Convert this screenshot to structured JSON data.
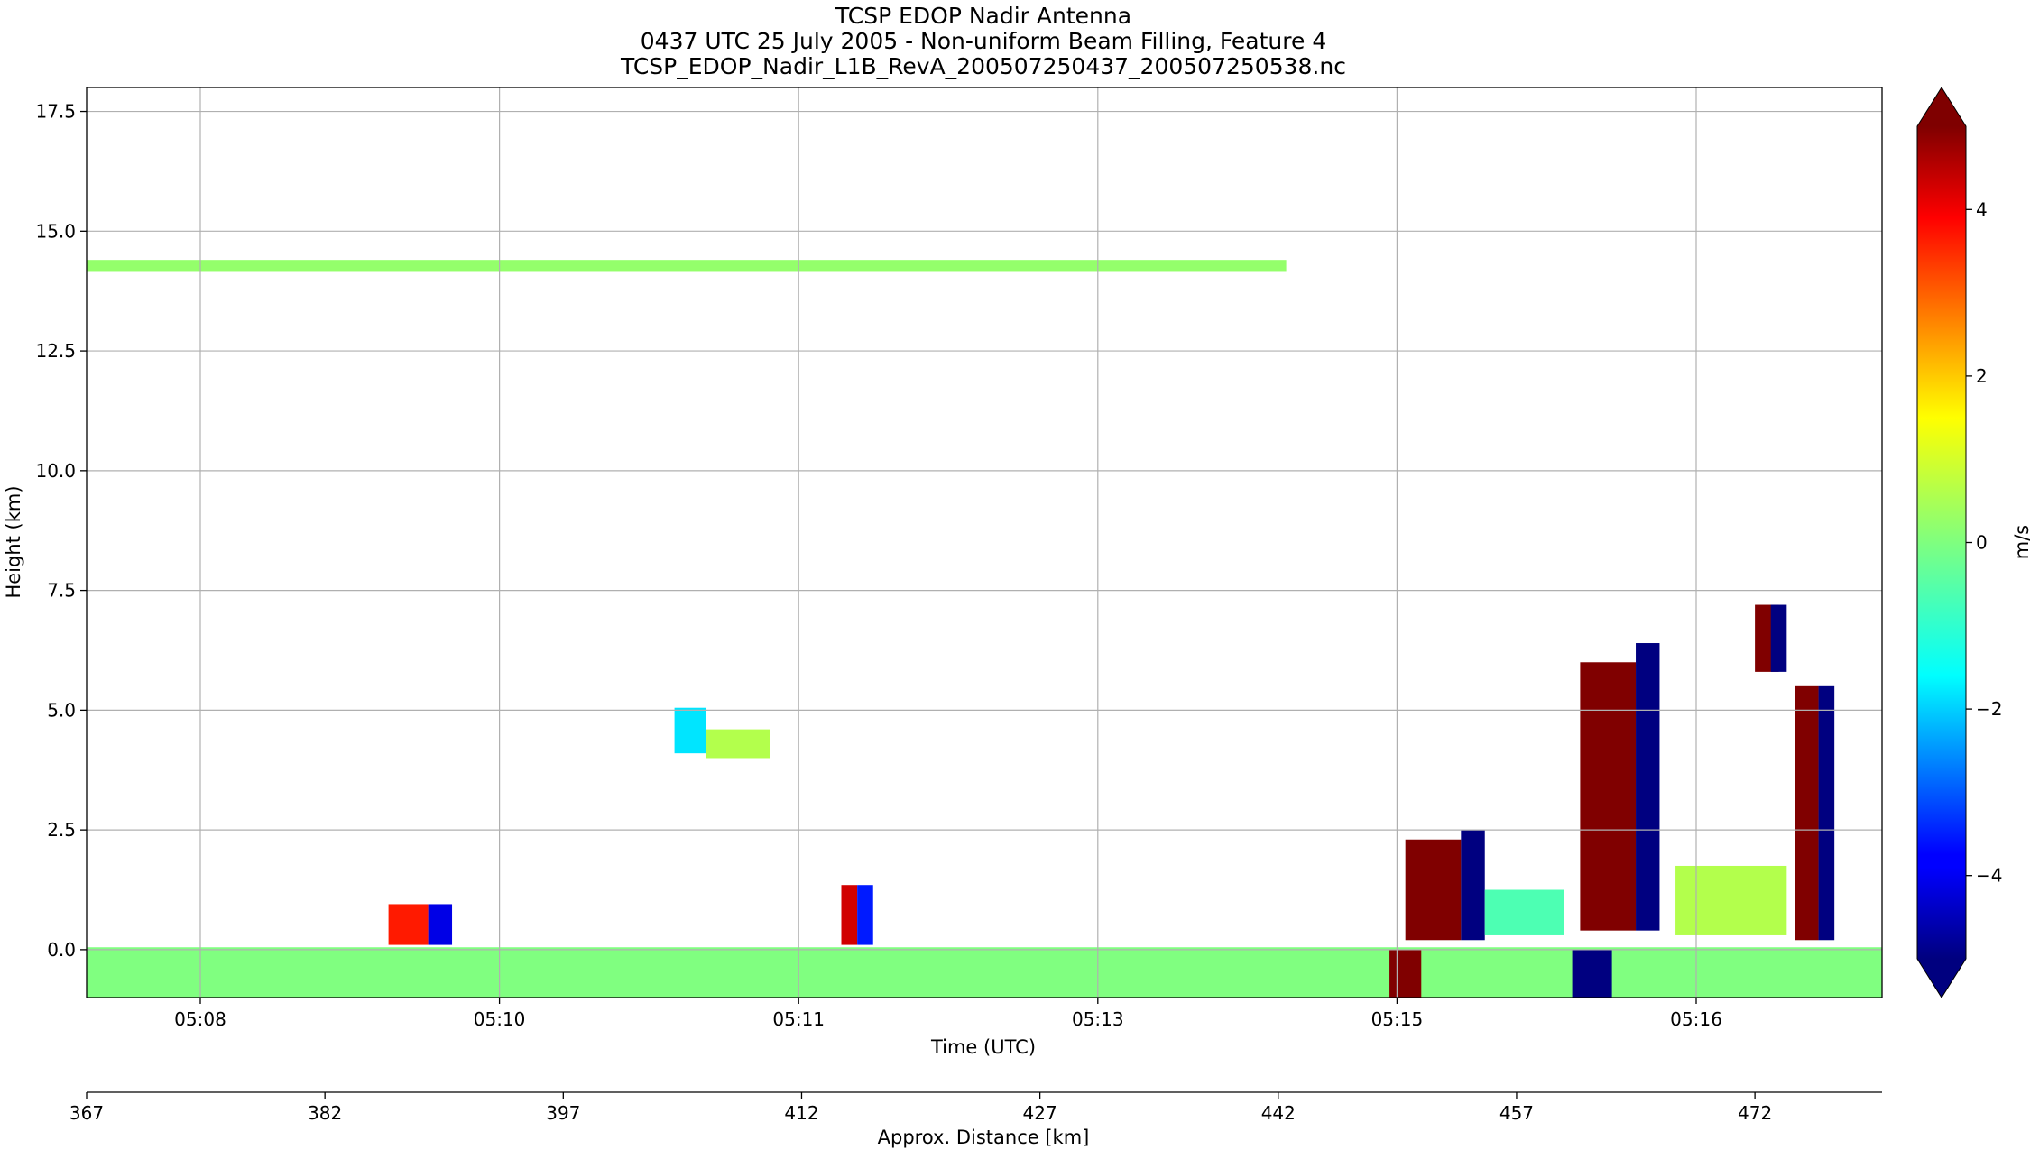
{
  "chart_data": {
    "type": "heatmap",
    "title_lines": [
      "TCSP EDOP Nadir Antenna",
      "0437 UTC 25 July 2005 - Non-uniform Beam Filling, Feature 4",
      "TCSP_EDOP_Nadir_L1B_RevA_200507250437_200507250538.nc"
    ],
    "xlabel": "Time (UTC)",
    "ylabel": "Height (km)",
    "secondary_xlabel": "Approx. Distance [km]",
    "colorbar_label": "m/s",
    "x_ticks": [
      "05:08",
      "05:10",
      "05:11",
      "05:13",
      "05:15",
      "05:16"
    ],
    "y_ticks": [
      0.0,
      2.5,
      5.0,
      7.5,
      10.0,
      12.5,
      15.0,
      17.5
    ],
    "y_tick_labels": [
      "0.0",
      "2.5",
      "5.0",
      "7.5",
      "10.0",
      "12.5",
      "15.0",
      "17.5"
    ],
    "ylim": [
      -1.0,
      18.0
    ],
    "xlim_km": [
      367,
      480
    ],
    "distance_ticks": [
      367,
      382,
      397,
      412,
      427,
      442,
      457,
      472
    ],
    "colorbar_ticks": [
      4,
      2,
      0,
      -2,
      -4
    ],
    "colorbar_tick_labels": [
      "4",
      "2",
      "0",
      "−2",
      "−4"
    ],
    "clim": [
      -5,
      5
    ],
    "colormap": "jet",
    "grid": true,
    "features": [
      {
        "kind": "layer",
        "x0": 367,
        "x1": 442.5,
        "y0": 14.15,
        "y1": 14.4,
        "v": 0.2
      },
      {
        "kind": "layer",
        "x0": 367,
        "x1": 480,
        "y0": -1.0,
        "y1": 0.05,
        "v": 0.0
      },
      {
        "kind": "cell",
        "x0": 386,
        "x1": 388.5,
        "y0": 0.1,
        "y1": 0.95,
        "v": 3.5
      },
      {
        "kind": "cell",
        "x0": 388.5,
        "x1": 390,
        "y0": 0.1,
        "y1": 0.95,
        "v": -4.0
      },
      {
        "kind": "cell",
        "x0": 404,
        "x1": 406,
        "y0": 4.1,
        "y1": 5.05,
        "v": -1.5
      },
      {
        "kind": "cell",
        "x0": 406,
        "x1": 410,
        "y0": 4.0,
        "y1": 4.6,
        "v": 0.5
      },
      {
        "kind": "cell",
        "x0": 414.5,
        "x1": 415.5,
        "y0": 0.1,
        "y1": 1.35,
        "v": 4.2
      },
      {
        "kind": "cell",
        "x0": 415.5,
        "x1": 416.5,
        "y0": 0.1,
        "y1": 1.35,
        "v": -3.5
      },
      {
        "kind": "cell",
        "x0": 450,
        "x1": 453.5,
        "y0": 0.2,
        "y1": 2.3,
        "v": 5.0
      },
      {
        "kind": "cell",
        "x0": 453.5,
        "x1": 455,
        "y0": 0.2,
        "y1": 2.5,
        "v": -5.0
      },
      {
        "kind": "cell",
        "x0": 455,
        "x1": 460,
        "y0": 0.3,
        "y1": 1.25,
        "v": -0.5
      },
      {
        "kind": "cell",
        "x0": 461,
        "x1": 464.5,
        "y0": 0.4,
        "y1": 6.0,
        "v": 5.0
      },
      {
        "kind": "cell",
        "x0": 464.5,
        "x1": 466,
        "y0": 0.4,
        "y1": 6.4,
        "v": -5.0
      },
      {
        "kind": "cell",
        "x0": 467,
        "x1": 474,
        "y0": 0.3,
        "y1": 1.75,
        "v": 0.5
      },
      {
        "kind": "cell",
        "x0": 472,
        "x1": 473.5,
        "y0": 5.8,
        "y1": 7.2,
        "v": 5.0
      },
      {
        "kind": "cell",
        "x0": 473,
        "x1": 474,
        "y0": 5.8,
        "y1": 7.2,
        "v": -5.0
      },
      {
        "kind": "cell",
        "x0": 474.5,
        "x1": 476,
        "y0": 0.2,
        "y1": 5.5,
        "v": 5.0
      },
      {
        "kind": "cell",
        "x0": 476,
        "x1": 477,
        "y0": 0.2,
        "y1": 5.5,
        "v": -5.0
      },
      {
        "kind": "cell",
        "x0": 449,
        "x1": 451,
        "y0": -1.0,
        "y1": 0.0,
        "v": 5.0
      },
      {
        "kind": "cell",
        "x0": 460.5,
        "x1": 463,
        "y0": -1.0,
        "y1": 0.0,
        "v": -5.0
      }
    ]
  }
}
